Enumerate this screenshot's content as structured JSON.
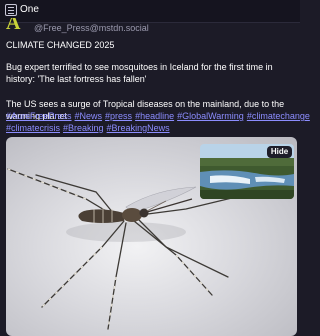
{
  "header": {
    "title": "One",
    "list_icon": "list-icon"
  },
  "post": {
    "avatar_letter": "A",
    "account": "@Free_Press@mstdn.social",
    "paragraph1": "CLIMATE CHANGED 2025",
    "paragraph2": "Bug expert terrified to see mosquitoes in Iceland for the first time in history: 'The last fortress has fallen'",
    "paragraph3": "The US sees a surge of Tropical diseases on the mainland, due to the warming planet",
    "hashtags": [
      "#AureFreePress",
      "#News",
      "#press",
      "#headline",
      "#GlobalWarming",
      "#climatechange",
      "#climatecrisis",
      "#Breaking",
      "#BreakingNews"
    ]
  },
  "media": {
    "hide_label": "Hide"
  },
  "colors": {
    "background": "#1c1b27",
    "link": "#8c8dff",
    "avatar": "#c9d23a",
    "muted": "#9b9aae"
  }
}
